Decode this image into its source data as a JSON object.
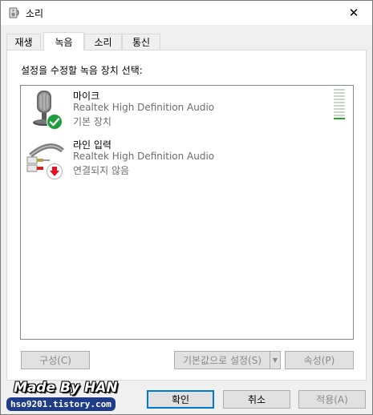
{
  "window": {
    "title": "소리",
    "close_glyph": "✕"
  },
  "tabs": [
    {
      "label": "재생",
      "active": false
    },
    {
      "label": "녹음",
      "active": true
    },
    {
      "label": "소리",
      "active": false
    },
    {
      "label": "통신",
      "active": false
    }
  ],
  "recording": {
    "instruction": "설정을 수정할 녹음 장치 선택:",
    "devices": [
      {
        "name": "마이크",
        "driver": "Realtek High Definition Audio",
        "status": "기본 장치",
        "icon": "microphone-icon",
        "badge": "default-check-icon"
      },
      {
        "name": "라인 입력",
        "driver": "Realtek High Definition Audio",
        "status": "연결되지 않음",
        "icon": "line-in-cable-icon",
        "badge": "disconnected-arrow-icon"
      }
    ],
    "level_meter": {
      "segments": 10,
      "lit": 1
    }
  },
  "panel_buttons": {
    "configure": "구성(C)",
    "set_default": "기본값으로 설정(S)",
    "properties": "속성(P)"
  },
  "dialog_buttons": {
    "ok": "확인",
    "cancel": "취소",
    "apply": "적용(A)"
  },
  "watermark": {
    "line1": "Made By HAN",
    "line2": "hso9201.tistory.com"
  },
  "colors": {
    "accent": "#0078d7",
    "check": "#1e9e3e",
    "error": "#e81123",
    "meter": "#27a52b"
  }
}
